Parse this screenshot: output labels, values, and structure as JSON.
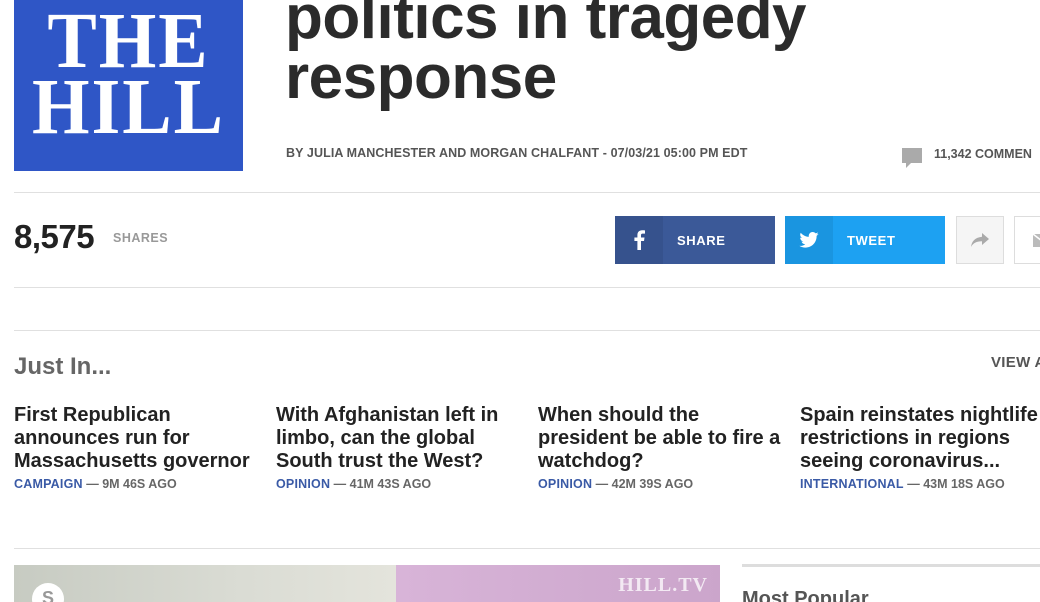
{
  "logo": {
    "line1": "THE",
    "line2": "HILL"
  },
  "article": {
    "headline": "politics in tragedy response",
    "byline": "BY JULIA MANCHESTER AND MORGAN CHALFANT - 07/03/21 05:00 PM EDT",
    "comments": "11,342 COMMEN"
  },
  "shares": {
    "count": "8,575",
    "label": "SHARES"
  },
  "social": {
    "facebook_label": "SHARE",
    "twitter_label": "TWEET"
  },
  "just_in": {
    "title": "Just In...",
    "view_all": "VIEW A",
    "stories": [
      {
        "title": "First Republican announces run for Massachusetts governor",
        "category": "CAMPAIGN",
        "time": "— 9M 46S AGO"
      },
      {
        "title": "With Afghanistan left in limbo, can the global South trust the West?",
        "category": "OPINION",
        "time": "— 41M 43S AGO"
      },
      {
        "title": "When should the president be able to fire a watchdog?",
        "category": "OPINION",
        "time": "— 42M 39S AGO"
      },
      {
        "title": "Spain reinstates nightlife restrictions in regions seeing coronavirus...",
        "category": "INTERNATIONAL",
        "time": "— 43M 18S AGO"
      }
    ]
  },
  "video": {
    "watermark": "HILL.TV"
  },
  "most_popular": {
    "title": "Most Popular"
  },
  "colors": {
    "brand": "#2f56c6",
    "facebook": "#3b5998",
    "twitter": "#1da1f2",
    "category": "#3a5aa6"
  }
}
